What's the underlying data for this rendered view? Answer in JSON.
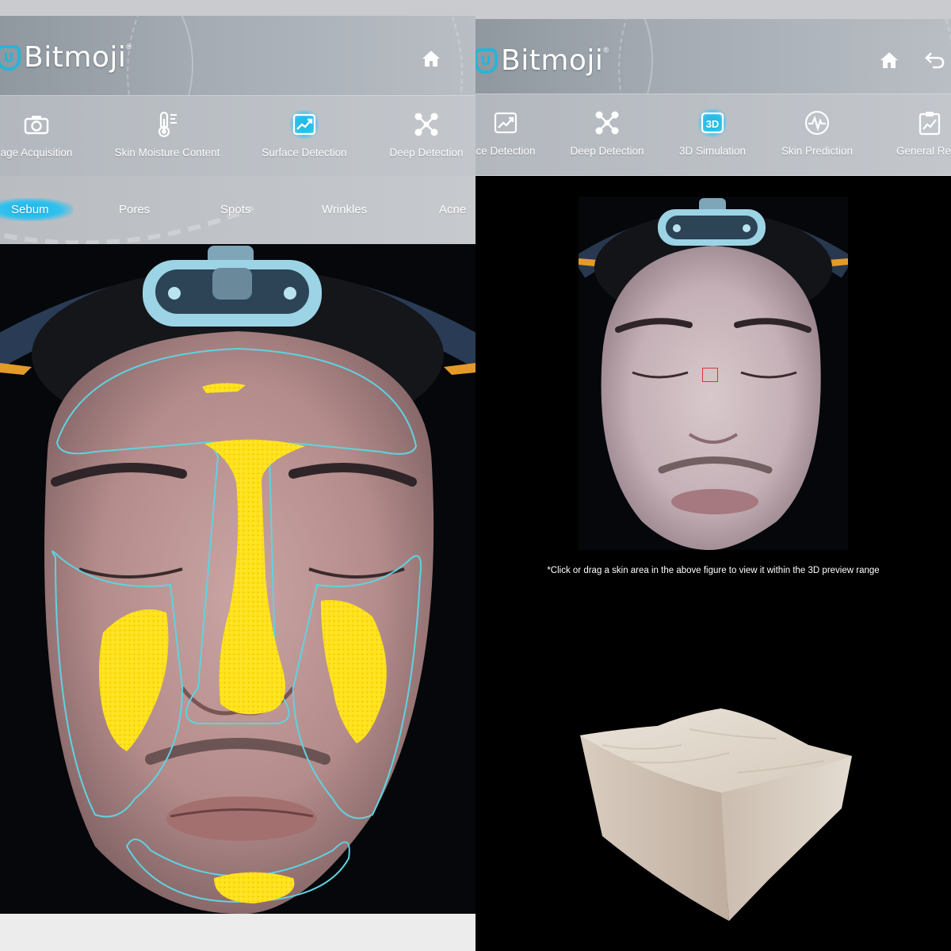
{
  "left_screen": {
    "brand": {
      "name": "Bitmoji",
      "reg": "®"
    },
    "header_icons": [
      "home-icon"
    ],
    "toolbar": [
      {
        "label": "age Acquisition",
        "icon": "camera-icon",
        "active": false
      },
      {
        "label": "Skin Moisture Content",
        "icon": "thermometer-icon",
        "active": false
      },
      {
        "label": "Surface Detection",
        "icon": "trend-chart-icon",
        "active": true
      },
      {
        "label": "Deep Detection",
        "icon": "molecule-icon",
        "active": false
      }
    ],
    "subtabs": [
      {
        "label": "Sebum",
        "active": true
      },
      {
        "label": "Pores",
        "active": false
      },
      {
        "label": "Spots",
        "active": false
      },
      {
        "label": "Wrinkles",
        "active": false
      },
      {
        "label": "Acne",
        "active": false
      }
    ]
  },
  "right_screen": {
    "brand": {
      "name": "Bitmoji",
      "reg": "®"
    },
    "header_icons": [
      "home-icon",
      "back-icon"
    ],
    "toolbar": [
      {
        "label": "ce Detection",
        "icon": "trend-chart-icon",
        "active": false
      },
      {
        "label": "Deep Detection",
        "icon": "molecule-icon",
        "active": false
      },
      {
        "label": "3D Simulation",
        "icon": "3d-icon",
        "active": true
      },
      {
        "label": "Skin Prediction",
        "icon": "pulse-icon",
        "active": false
      },
      {
        "label": "General Repo",
        "icon": "report-clipboard-icon",
        "active": false
      }
    ],
    "note": "*Click or drag a skin area in the above figure to view it within the 3D preview range"
  },
  "colors": {
    "accent": "#2ec0ef",
    "sebum_highlight": "#ffe21a",
    "zone_outline": "#5fd3e0",
    "selection_box": "#d23a3a"
  }
}
